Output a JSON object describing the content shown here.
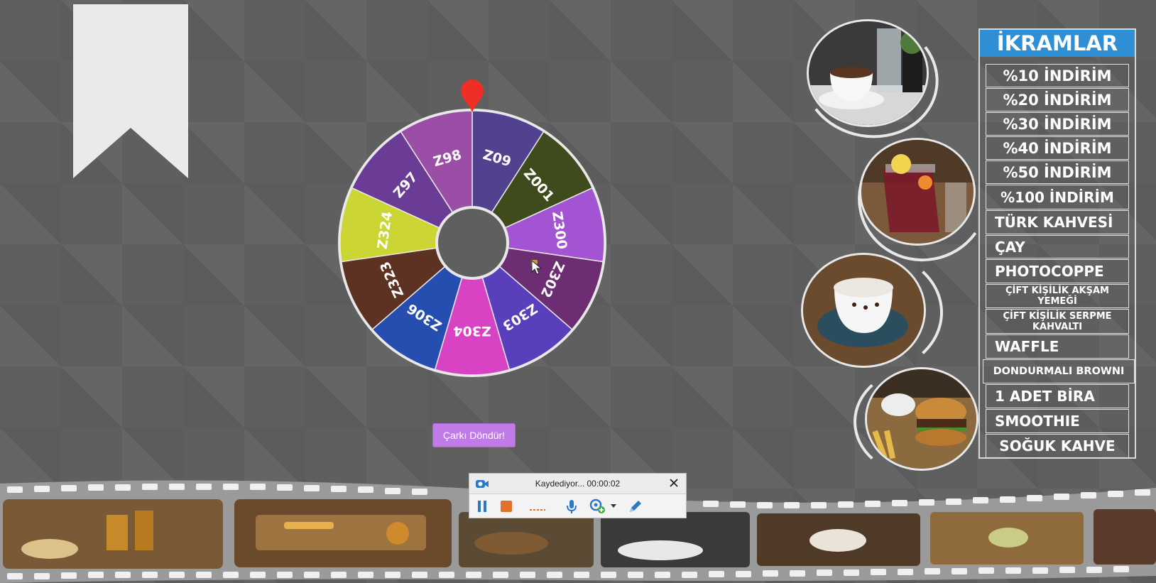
{
  "wheel": {
    "segments": [
      {
        "label": "Z09",
        "color": "#52418f"
      },
      {
        "label": "Z001",
        "color": "#3f4b1d"
      },
      {
        "label": "Z300",
        "color": "#a354d3"
      },
      {
        "label": "Z302",
        "color": "#6d2d73"
      },
      {
        "label": "Z303",
        "color": "#5a3fbd"
      },
      {
        "label": "Z304",
        "color": "#d843c3"
      },
      {
        "label": "Z306",
        "color": "#254eb0"
      },
      {
        "label": "Z323",
        "color": "#5d3222"
      },
      {
        "label": "Z324",
        "color": "#cbd534"
      },
      {
        "label": "Z97",
        "color": "#6a3c95"
      },
      {
        "label": "Z98",
        "color": "#9b4ea5"
      }
    ],
    "pointer_color": "#ef2f25",
    "spin_button_label": "Çarkı Döndür!"
  },
  "ikramlar": {
    "title": "İKRAMLAR",
    "items": [
      "%10 İNDİRİM",
      "%20 İNDİRİM",
      "%30 İNDİRİM",
      "%40 İNDİRİM",
      "%50 İNDİRİM",
      "%100 İNDİRİM",
      "TÜRK KAHVESİ",
      "ÇAY",
      "PHOTOCOPPE",
      "ÇİFT KİŞİLİK AKŞAM YEMEĞİ",
      "ÇİFT KİŞİLİK SERPME KAHVALTI",
      "WAFFLE",
      "DONDURMALI BROWNI",
      "1 ADET BİRA",
      "SMOOTHIE",
      "SOĞUK KAHVE"
    ]
  },
  "photos": [
    "turkish-coffee",
    "iced-tea-pitcher",
    "cappuccino",
    "burger"
  ],
  "recorder": {
    "status": "Kaydediyor... 00:00:02"
  },
  "colors": {
    "accent_blue": "#2f8fd5",
    "button_purple": "#c07be6",
    "recorder_stop": "#e0702a"
  }
}
